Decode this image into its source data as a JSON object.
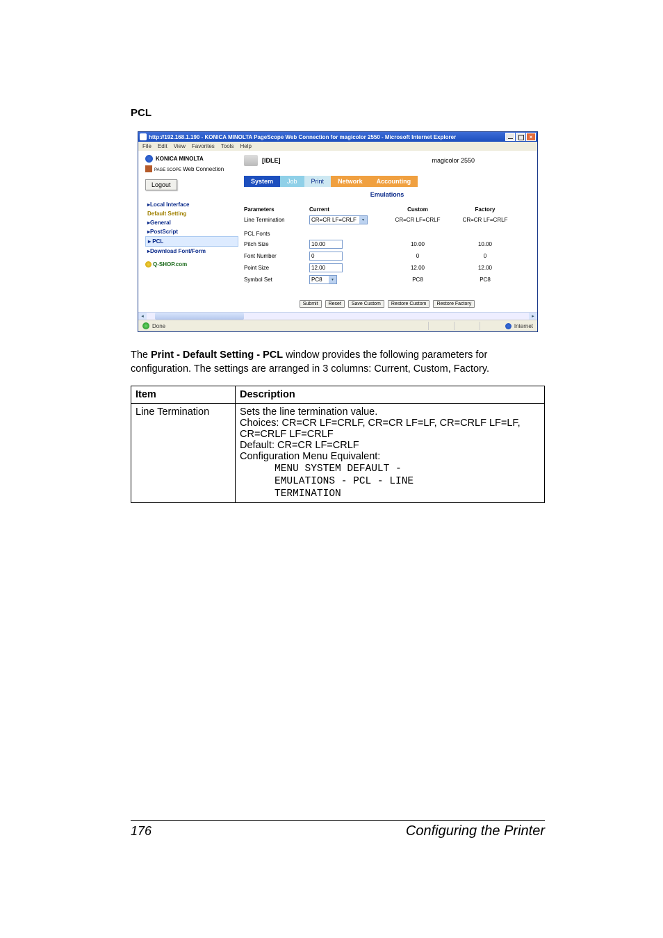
{
  "section_title": "PCL",
  "browser": {
    "title": "http://192.168.1.190 - KONICA MINOLTA PageScope Web Connection for magicolor 2550 - Microsoft Internet Explorer",
    "menus": [
      "File",
      "Edit",
      "View",
      "Favorites",
      "Tools",
      "Help"
    ],
    "brand": "KONICA MINOLTA",
    "subbrand_prefix": "PAGE SCOPE",
    "subbrand": "Web Connection",
    "logout": "Logout",
    "nav": {
      "local_interface": "▸Local Interface",
      "default_setting": "Default Setting",
      "general": "▸General",
      "postscript": "▸PostScript",
      "pcl": "▸ PCL",
      "download": "▸Download Font/Form"
    },
    "qshop": "Q-SHOP.com",
    "status_state": "[IDLE]",
    "device": "magicolor 2550",
    "tabs": [
      "System",
      "Job",
      "Print",
      "Network",
      "Accounting"
    ],
    "panel_title": "Emulations",
    "columns": {
      "p": "Parameters",
      "c": "Current",
      "cu": "Custom",
      "f": "Factory"
    },
    "rows": {
      "line_term": {
        "label": "Line Termination",
        "current": "CR=CR LF=CRLF",
        "custom": "CR=CR LF=CRLF",
        "factory": "CR=CR LF=CRLF"
      },
      "pcl_fonts": "PCL Fonts",
      "pitch": {
        "label": "Pitch Size",
        "current": "10.00",
        "custom": "10.00",
        "factory": "10.00"
      },
      "font_num": {
        "label": "Font Number",
        "current": "0",
        "custom": "0",
        "factory": "0"
      },
      "point": {
        "label": "Point Size",
        "current": "12.00",
        "custom": "12.00",
        "factory": "12.00"
      },
      "symset": {
        "label": "Symbol Set",
        "current": "PC8",
        "custom": "PC8",
        "factory": "PC8"
      }
    },
    "buttons": [
      "Submit",
      "Reset",
      "Save Custom",
      "Restore Custom",
      "Restore Factory"
    ],
    "statusbar": {
      "done": "Done",
      "internet": "Internet"
    }
  },
  "explain": {
    "line1_prefix": "The ",
    "line1_bold": "Print - Default Setting - PCL",
    "line1_suffix": " window provides the following parameters for configuration. The settings are arranged in 3 columns: Current, Custom, Factory."
  },
  "table": {
    "hdr_item": "Item",
    "hdr_desc": "Description",
    "row1": {
      "item": "Line Termination",
      "l1": "Sets the line termination value.",
      "l2": "Choices: CR=CR LF=CRLF, CR=CR LF=LF, CR=CRLF LF=LF, CR=CRLF LF=CRLF",
      "l3": "Default: CR=CR LF=CRLF",
      "l4": "Configuration Menu Equivalent:",
      "m1": "MENU SYSTEM DEFAULT -",
      "m2": "EMULATIONS - PCL - LINE",
      "m3": "TERMINATION"
    }
  },
  "footer": {
    "page": "176",
    "title": "Configuring the Printer"
  }
}
